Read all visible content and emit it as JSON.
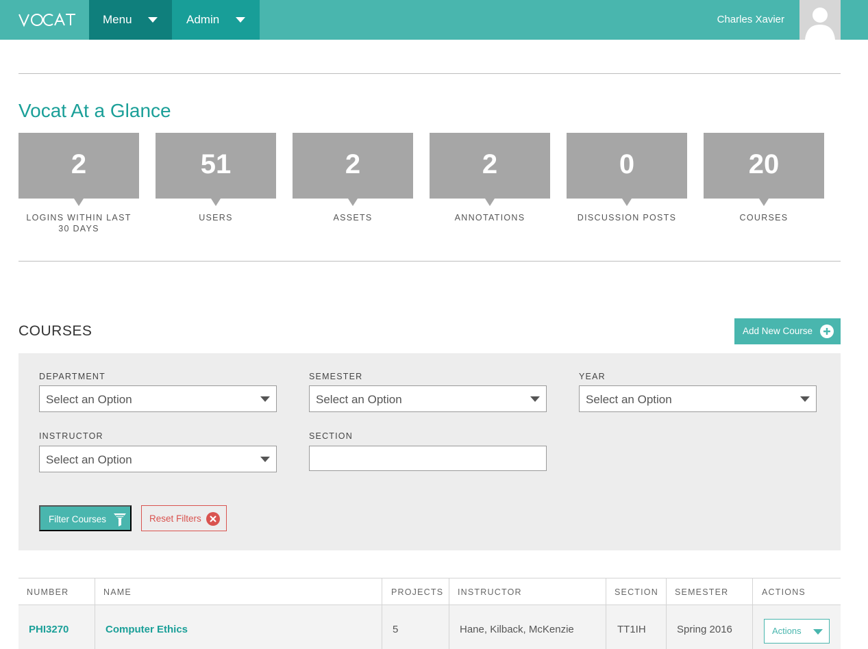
{
  "header": {
    "logo_text": "VOCAT",
    "menu_label": "Menu",
    "admin_label": "Admin",
    "user_name": "Charles Xavier"
  },
  "glance": {
    "title": "Vocat At a Glance",
    "stats": [
      {
        "value": "2",
        "label": "LOGINS WITHIN LAST 30 DAYS"
      },
      {
        "value": "51",
        "label": "USERS"
      },
      {
        "value": "2",
        "label": "ASSETS"
      },
      {
        "value": "2",
        "label": "ANNOTATIONS"
      },
      {
        "value": "0",
        "label": "DISCUSSION POSTS"
      },
      {
        "value": "20",
        "label": "COURSES"
      }
    ]
  },
  "courses": {
    "title": "COURSES",
    "add_button": "Add New Course",
    "filters": {
      "department_label": "DEPARTMENT",
      "department_value": "Select an Option",
      "semester_label": "SEMESTER",
      "semester_value": "Select an Option",
      "year_label": "YEAR",
      "year_value": "Select an Option",
      "instructor_label": "INSTRUCTOR",
      "instructor_value": "Select an Option",
      "section_label": "SECTION",
      "section_value": "",
      "filter_button": "Filter Courses",
      "reset_button": "Reset Filters"
    },
    "table": {
      "columns": [
        "NUMBER",
        "NAME",
        "PROJECTS",
        "INSTRUCTOR",
        "SECTION",
        "SEMESTER",
        "ACTIONS"
      ],
      "rows": [
        {
          "number": "PHI3270",
          "name": "Computer Ethics",
          "projects": "5",
          "instructor": "Hane, Kilback, McKenzie",
          "section": "TT1IH",
          "semester": "Spring 2016",
          "actions": "Actions"
        }
      ]
    }
  },
  "colors": {
    "brand_teal": "#49b6ae",
    "nav_menu_bg": "#0f7f7c",
    "nav_admin_bg": "#189e98",
    "stat_gray": "#a6a6a6",
    "reset_red": "#d9534f"
  },
  "icons": [
    "vocat-logo",
    "chevron-down-icon",
    "user-avatar-icon",
    "plus-circle-icon",
    "funnel-icon",
    "close-circle-icon"
  ]
}
